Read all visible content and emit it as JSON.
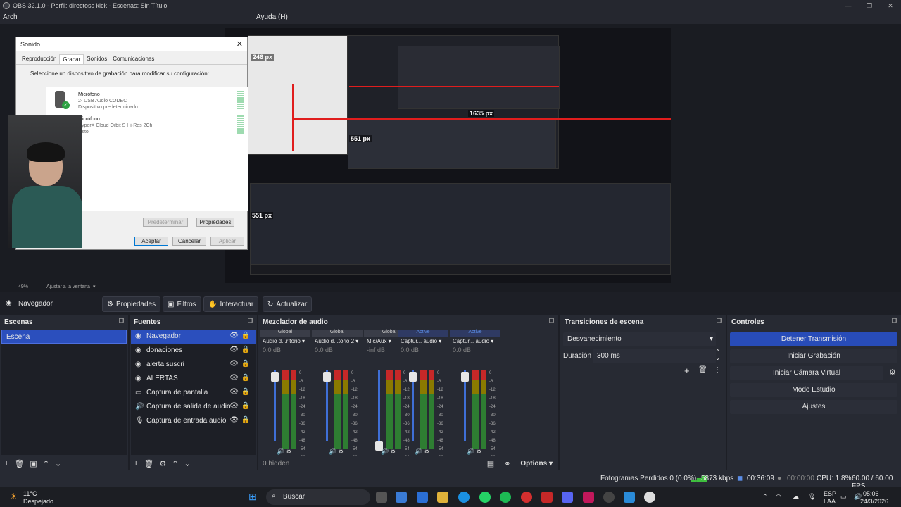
{
  "window": {
    "title": "OBS 32.1.0 - Perfil: directoss kick - Escenas: Sin Título"
  },
  "menu": {
    "archivo": "Arch",
    "ayuda": "Ayuda (H)"
  },
  "dialog": {
    "title": "Sonido",
    "tabs": [
      "Reproducción",
      "Grabar",
      "Sonidos",
      "Comunicaciones"
    ],
    "instruction": "Seleccione un dispositivo de grabación para modificar su configuración:",
    "devices": [
      {
        "name": "Micrófono",
        "detail": "2- USB Audio CODEC",
        "status": "Dispositivo predeterminado"
      },
      {
        "name": "Micrófono",
        "detail": "HyperX Cloud Orbit S Hi-Res 2Ch",
        "status": "Listo"
      }
    ],
    "buttons": {
      "default": "Predeterminar",
      "properties": "Propiedades",
      "ok": "Aceptar",
      "cancel": "Cancelar",
      "apply": "Aplicar"
    }
  },
  "preview_labels": {
    "w1": "246 px",
    "w2": "1635 px",
    "h1": "551 px",
    "h2": "551 px"
  },
  "zoom": {
    "value": "49%",
    "fit": "Ajustar a la ventana"
  },
  "source_bar": {
    "selected": "Navegador",
    "properties": "Propiedades",
    "filters": "Filtros",
    "interact": "Interactuar",
    "refresh": "Actualizar"
  },
  "scenes": {
    "title": "Escenas",
    "items": [
      "Escena"
    ]
  },
  "sources": {
    "title": "Fuentes",
    "items": [
      {
        "label": "Navegador",
        "icon": "globe-icon"
      },
      {
        "label": "donaciones",
        "icon": "globe-icon"
      },
      {
        "label": "alerta suscri",
        "icon": "globe-icon"
      },
      {
        "label": "ALERTAS",
        "icon": "globe-icon"
      },
      {
        "label": "Captura de pantalla",
        "icon": "monitor-icon"
      },
      {
        "label": "Captura de salida de audio",
        "icon": "speaker-icon"
      },
      {
        "label": "Captura de entrada audio",
        "icon": "mic-icon"
      }
    ]
  },
  "mixer": {
    "title": "Mezclador de audio",
    "hidden": "0 hidden",
    "options": "Options",
    "channels": [
      {
        "tag": "Global",
        "name": "Audio d...ritorio",
        "db": "0.0 dB"
      },
      {
        "tag": "Global",
        "name": "Audio d...torio 2",
        "db": "0.0 dB"
      },
      {
        "tag": "Global",
        "name": "Mic/Aux",
        "db": "-inf dB"
      },
      {
        "tag": "Active",
        "name": "Captur... audio",
        "db": "0.0 dB"
      },
      {
        "tag": "Active",
        "name": "Captur... audio",
        "db": "0.0 dB"
      }
    ],
    "scale": [
      "0",
      "-6",
      "-12",
      "-18",
      "-24",
      "-30",
      "-36",
      "-42",
      "-48",
      "-54",
      "-60"
    ]
  },
  "transitions": {
    "title": "Transiciones de escena",
    "type": "Desvanecimiento",
    "duration_label": "Duración",
    "duration": "300 ms"
  },
  "controls": {
    "title": "Controles",
    "stop_stream": "Detener Transmisión",
    "start_rec": "Iniciar Grabación",
    "virtual_cam": "Iniciar Cámara Virtual",
    "studio": "Modo Estudio",
    "settings": "Ajustes"
  },
  "status": {
    "dropped": "Fotogramas Perdidos 0 (0.0%)",
    "kbps": "5873 kbps",
    "stream_time": "00:36:09",
    "rec_time": "00:00:00",
    "cpu": "CPU: 1.8%",
    "fps": "60.00 / 60.00 FPS"
  },
  "taskbar": {
    "temp": "11°C",
    "weather": "Despejado",
    "search": "Buscar",
    "lang1": "ESP",
    "lang2": "LAA",
    "time": "05:06",
    "date": "24/3/2026"
  },
  "colors": {
    "accent": "#2b4fbd",
    "red": "#e01d1d"
  }
}
